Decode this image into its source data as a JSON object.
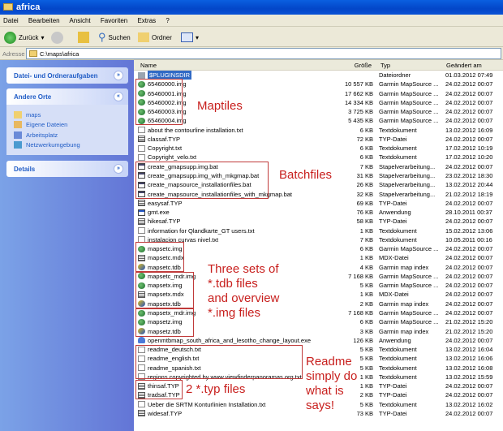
{
  "window": {
    "title": "africa"
  },
  "menu": [
    "Datei",
    "Bearbeiten",
    "Ansicht",
    "Favoriten",
    "Extras",
    "?"
  ],
  "toolbar": {
    "back": "Zurück",
    "search": "Suchen",
    "folders": "Ordner"
  },
  "address": {
    "label": "Adresse",
    "value": "C:\\maps\\africa"
  },
  "sidebar": {
    "tasks": "Datei- und Ordneraufgaben",
    "other_places": "Andere Orte",
    "places": [
      "maps",
      "Eigene Dateien",
      "Arbeitsplatz",
      "Netzwerkumgebung"
    ],
    "details": "Details"
  },
  "columns": {
    "name": "Name",
    "size": "Größe",
    "type": "Typ",
    "modified": "Geändert am"
  },
  "files": [
    {
      "name": "$PLUGINSDIR",
      "size": "",
      "type": "Dateiordner",
      "date": "01.03.2012 07:49",
      "icon": "dir"
    },
    {
      "name": "65460000.img",
      "size": "10 557 KB",
      "type": "Garmin MapSource ...",
      "date": "24.02.2012 00:07",
      "icon": "img"
    },
    {
      "name": "65460001.img",
      "size": "17 662 KB",
      "type": "Garmin MapSource ...",
      "date": "24.02.2012 00:07",
      "icon": "img"
    },
    {
      "name": "65460002.img",
      "size": "14 334 KB",
      "type": "Garmin MapSource ...",
      "date": "24.02.2012 00:07",
      "icon": "img"
    },
    {
      "name": "65460003.img",
      "size": "3 725 KB",
      "type": "Garmin MapSource ...",
      "date": "24.02.2012 00:07",
      "icon": "img"
    },
    {
      "name": "65460004.img",
      "size": "5 435 KB",
      "type": "Garmin MapSource ...",
      "date": "24.02.2012 00:07",
      "icon": "img"
    },
    {
      "name": "about the contourline installation.txt",
      "size": "6 KB",
      "type": "Textdokument",
      "date": "13.02.2012 16:09",
      "icon": "txt"
    },
    {
      "name": "classaf.TYP",
      "size": "72 KB",
      "type": "TYP-Datei",
      "date": "24.02.2012 00:07",
      "icon": "typ"
    },
    {
      "name": "Copyright.txt",
      "size": "6 KB",
      "type": "Textdokument",
      "date": "17.02.2012 10:19",
      "icon": "txt"
    },
    {
      "name": "Copyright_velo.txt",
      "size": "6 KB",
      "type": "Textdokument",
      "date": "17.02.2012 10:20",
      "icon": "txt"
    },
    {
      "name": "create_gmapsupp.img.bat",
      "size": "7 KB",
      "type": "Stapelverarbeitung...",
      "date": "24.02.2012 00:07",
      "icon": "bat"
    },
    {
      "name": "create_gmapsupp.img_with_mkgmap.bat",
      "size": "31 KB",
      "type": "Stapelverarbeitung...",
      "date": "23.02.2012 18:30",
      "icon": "bat"
    },
    {
      "name": "create_mapsource_installationfiles.bat",
      "size": "26 KB",
      "type": "Stapelverarbeitung...",
      "date": "13.02.2012 20:44",
      "icon": "bat"
    },
    {
      "name": "create_mapsource_installationfiles_with_mkgmap.bat",
      "size": "32 KB",
      "type": "Stapelverarbeitung...",
      "date": "21.02.2012 18:19",
      "icon": "bat"
    },
    {
      "name": "easysaf.TYP",
      "size": "69 KB",
      "type": "TYP-Datei",
      "date": "24.02.2012 00:07",
      "icon": "typ"
    },
    {
      "name": "gmt.exe",
      "size": "76 KB",
      "type": "Anwendung",
      "date": "28.10.2011 00:37",
      "icon": "exe"
    },
    {
      "name": "hikesaf.TYP",
      "size": "58 KB",
      "type": "TYP-Datei",
      "date": "24.02.2012 00:07",
      "icon": "typ"
    },
    {
      "name": "information for Qlandkarte_GT users.txt",
      "size": "1 KB",
      "type": "Textdokument",
      "date": "15.02.2012 13:06",
      "icon": "txt"
    },
    {
      "name": "instalacion curvas nivel.txt",
      "size": "7 KB",
      "type": "Textdokument",
      "date": "10.05.2011 00:16",
      "icon": "txt"
    },
    {
      "name": "mapsetc.img",
      "size": "6 KB",
      "type": "Garmin MapSource ...",
      "date": "24.02.2012 00:07",
      "icon": "img"
    },
    {
      "name": "mapsetc.mdx",
      "size": "1 KB",
      "type": "MDX-Datei",
      "date": "24.02.2012 00:07",
      "icon": "mdx"
    },
    {
      "name": "mapsetc.tdb",
      "size": "4 KB",
      "type": "Garmin map index",
      "date": "24.02.2012 00:07",
      "icon": "tdb"
    },
    {
      "name": "mapsetc_mdr.img",
      "size": "7 168 KB",
      "type": "Garmin MapSource ...",
      "date": "24.02.2012 00:07",
      "icon": "img"
    },
    {
      "name": "mapsetx.img",
      "size": "5 KB",
      "type": "Garmin MapSource ...",
      "date": "24.02.2012 00:07",
      "icon": "img"
    },
    {
      "name": "mapsetx.mdx",
      "size": "1 KB",
      "type": "MDX-Datei",
      "date": "24.02.2012 00:07",
      "icon": "mdx"
    },
    {
      "name": "mapsetx.tdb",
      "size": "2 KB",
      "type": "Garmin map index",
      "date": "24.02.2012 00:07",
      "icon": "tdb"
    },
    {
      "name": "mapsetx_mdr.img",
      "size": "7 168 KB",
      "type": "Garmin MapSource ...",
      "date": "24.02.2012 00:07",
      "icon": "img"
    },
    {
      "name": "mapsetz.img",
      "size": "6 KB",
      "type": "Garmin MapSource ...",
      "date": "21.02.2012 15:20",
      "icon": "img"
    },
    {
      "name": "mapsetz.tdb",
      "size": "3 KB",
      "type": "Garmin map index",
      "date": "21.02.2012 15:20",
      "icon": "tdb"
    },
    {
      "name": "openmtbmap_south_africa_and_lesotho_change_layout.exe",
      "size": "126 KB",
      "type": "Anwendung",
      "date": "24.02.2012 00:07",
      "icon": "setup"
    },
    {
      "name": "readme_deutsch.txt",
      "size": "5 KB",
      "type": "Textdokument",
      "date": "13.02.2012 16:04",
      "icon": "txt"
    },
    {
      "name": "readme_english.txt",
      "size": "5 KB",
      "type": "Textdokument",
      "date": "13.02.2012 16:06",
      "icon": "txt"
    },
    {
      "name": "readme_spanish.txt",
      "size": "5 KB",
      "type": "Textdokument",
      "date": "13.02.2012 16:08",
      "icon": "txt"
    },
    {
      "name": "regions copyrighted by www.viewfinderpanoramas.org.txt",
      "size": "1 KB",
      "type": "Textdokument",
      "date": "13.02.2012 15:59",
      "icon": "txt"
    },
    {
      "name": "thinsaf.TYP",
      "size": "1 KB",
      "type": "TYP-Datei",
      "date": "24.02.2012 00:07",
      "icon": "typ"
    },
    {
      "name": "tradsaf.TYP",
      "size": "2 KB",
      "type": "TYP-Datei",
      "date": "24.02.2012 00:07",
      "icon": "typ"
    },
    {
      "name": "Ueber die SRTM Konturlinien Installation.txt",
      "size": "5 KB",
      "type": "Textdokument",
      "date": "13.02.2012 16:02",
      "icon": "txt"
    },
    {
      "name": "widesaf.TYP",
      "size": "73 KB",
      "type": "TYP-Datei",
      "date": "24.02.2012 00:07",
      "icon": "typ"
    }
  ],
  "annotations": {
    "maptiles": "Maptiles",
    "batchfiles": "Batchfiles",
    "sets": [
      "Three sets of",
      "*.tdb files",
      "and overview",
      "*.img files"
    ],
    "readme": [
      "Readme",
      "simply do",
      "what is",
      "says!"
    ],
    "typ": "2 *.typ files"
  },
  "colors": {
    "annotation": "#c8201e",
    "title": "#0a5fe0",
    "selection": "#316ac5"
  }
}
